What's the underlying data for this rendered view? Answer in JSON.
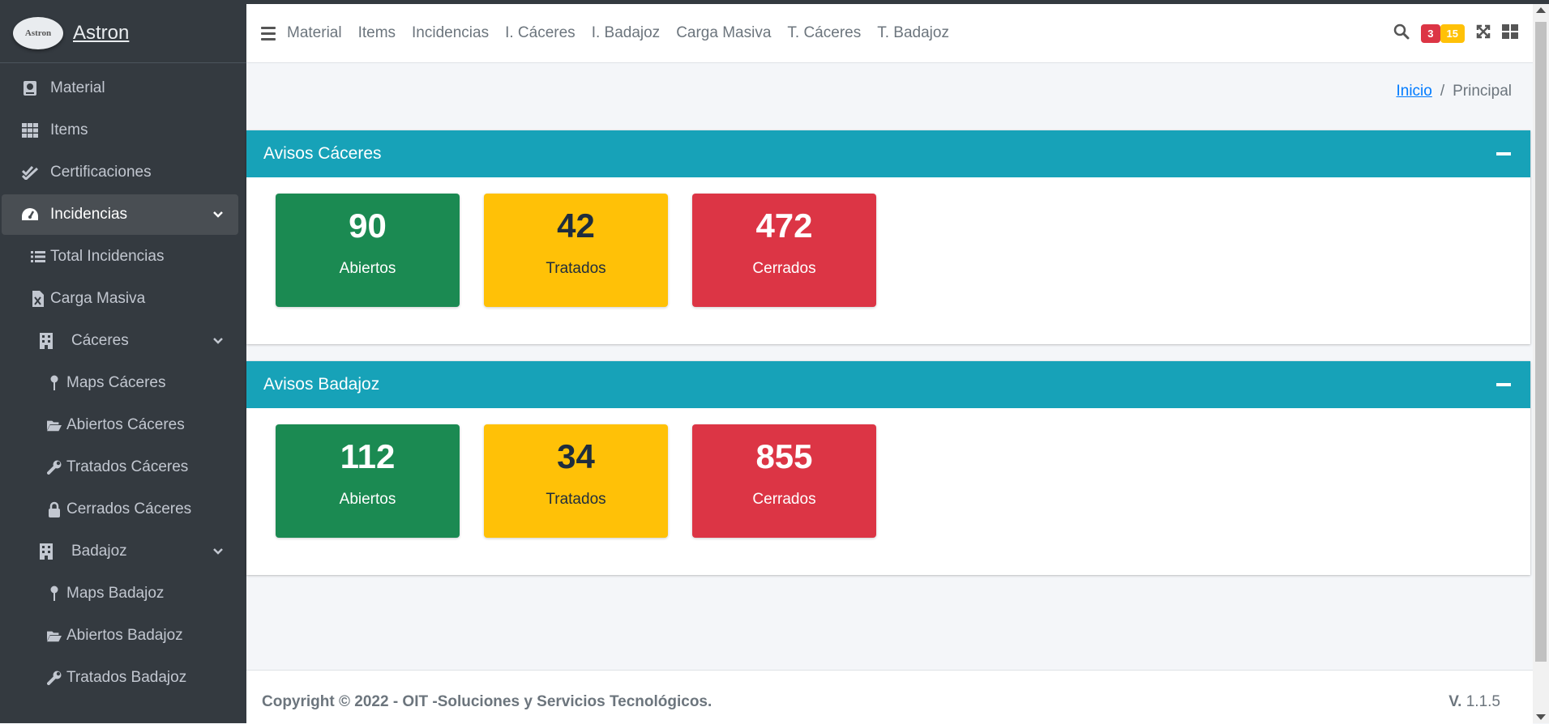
{
  "brand": {
    "logo_text": "Astron",
    "name": "Astron"
  },
  "sidebar": {
    "items": [
      {
        "label": "Material"
      },
      {
        "label": "Items"
      },
      {
        "label": "Certificaciones"
      },
      {
        "label": "Incidencias"
      },
      {
        "label": "Total Incidencias"
      },
      {
        "label": "Carga Masiva"
      },
      {
        "label": "Cáceres"
      },
      {
        "label": "Maps Cáceres"
      },
      {
        "label": "Abiertos Cáceres"
      },
      {
        "label": "Tratados Cáceres"
      },
      {
        "label": "Cerrados Cáceres"
      },
      {
        "label": "Badajoz"
      },
      {
        "label": "Maps Badajoz"
      },
      {
        "label": "Abiertos Badajoz"
      },
      {
        "label": "Tratados Badajoz"
      }
    ]
  },
  "topnav": {
    "links": [
      "Material",
      "Items",
      "Incidencias",
      "I. Cáceres",
      "I. Badajoz",
      "Carga Masiva",
      "T. Cáceres",
      "T. Badajoz"
    ],
    "badge_danger": "3",
    "badge_warning": "15"
  },
  "breadcrumb": {
    "home": "Inicio",
    "sep": "/",
    "current": "Principal"
  },
  "cards": [
    {
      "title": "Avisos Cáceres",
      "stats": [
        {
          "value": "90",
          "label": "Abiertos"
        },
        {
          "value": "42",
          "label": "Tratados"
        },
        {
          "value": "472",
          "label": "Cerrados"
        }
      ]
    },
    {
      "title": "Avisos Badajoz",
      "stats": [
        {
          "value": "112",
          "label": "Abiertos"
        },
        {
          "value": "34",
          "label": "Tratados"
        },
        {
          "value": "855",
          "label": "Cerrados"
        }
      ]
    }
  ],
  "footer": {
    "copyright": "Copyright © 2022 - OIT -Soluciones y Servicios Tecnológicos.",
    "version_prefix": "V.",
    "version": "1.1.5"
  },
  "colors": {
    "sidebar": "#343a40",
    "header": "#17a2b8",
    "success": "#1b8a52",
    "warning": "#ffc107",
    "danger": "#dc3545"
  }
}
